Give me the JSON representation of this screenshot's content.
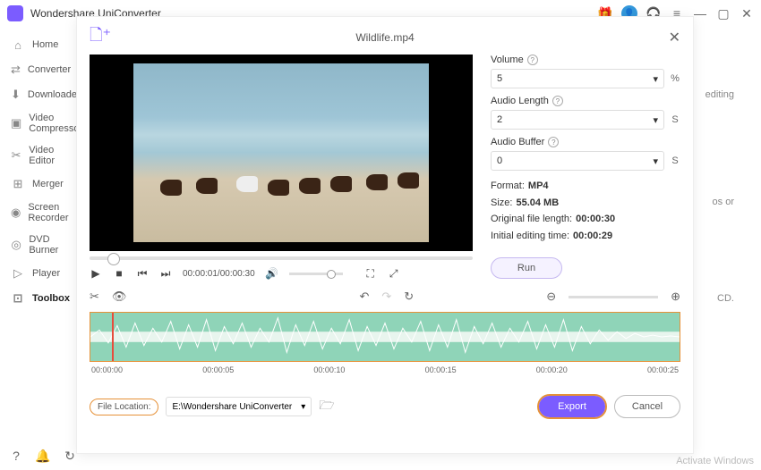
{
  "app": {
    "name": "Wondershare UniConverter"
  },
  "sidebar": {
    "items": [
      {
        "icon": "⌂",
        "label": "Home"
      },
      {
        "icon": "⇄",
        "label": "Converter"
      },
      {
        "icon": "⬇",
        "label": "Downloader"
      },
      {
        "icon": "▣",
        "label": "Video Compressor"
      },
      {
        "icon": "✂",
        "label": "Video Editor"
      },
      {
        "icon": "⊞",
        "label": "Merger"
      },
      {
        "icon": "◉",
        "label": "Screen Recorder"
      },
      {
        "icon": "◎",
        "label": "DVD Burner"
      },
      {
        "icon": "▷",
        "label": "Player"
      },
      {
        "icon": "⊡",
        "label": "Toolbox"
      }
    ]
  },
  "modal": {
    "title": "Wildlife.mp4",
    "volume": {
      "label": "Volume",
      "value": "5",
      "unit": "%"
    },
    "audio_length": {
      "label": "Audio Length",
      "value": "2",
      "unit": "S"
    },
    "audio_buffer": {
      "label": "Audio Buffer",
      "value": "0",
      "unit": "S"
    },
    "meta": {
      "format_label": "Format:",
      "format": "MP4",
      "size_label": "Size:",
      "size": "55.04 MB",
      "orig_label": "Original file length:",
      "orig": "00:00:30",
      "init_label": "Initial editing time:",
      "init": "00:00:29"
    },
    "run": "Run",
    "time": "00:00:01/00:00:30",
    "ruler": [
      "00:00:00",
      "00:00:05",
      "00:00:10",
      "00:00:15",
      "00:00:20",
      "00:00:25"
    ],
    "file_location_label": "File Location:",
    "path": "E:\\Wondershare UniConverter",
    "export": "Export",
    "cancel": "Cancel"
  },
  "bg": {
    "t1": "editing",
    "t2": "os or",
    "t3": "CD."
  },
  "activate": "Activate Windows"
}
